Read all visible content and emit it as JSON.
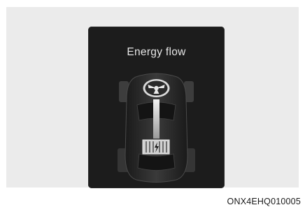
{
  "screen": {
    "title": "Energy flow",
    "background": "#1c1c1c",
    "icons": [
      "car-top-view-icon",
      "engine-icon",
      "battery-icon",
      "energy-flow-arrow-icon"
    ]
  },
  "caption": "ONX4EHQ010005"
}
